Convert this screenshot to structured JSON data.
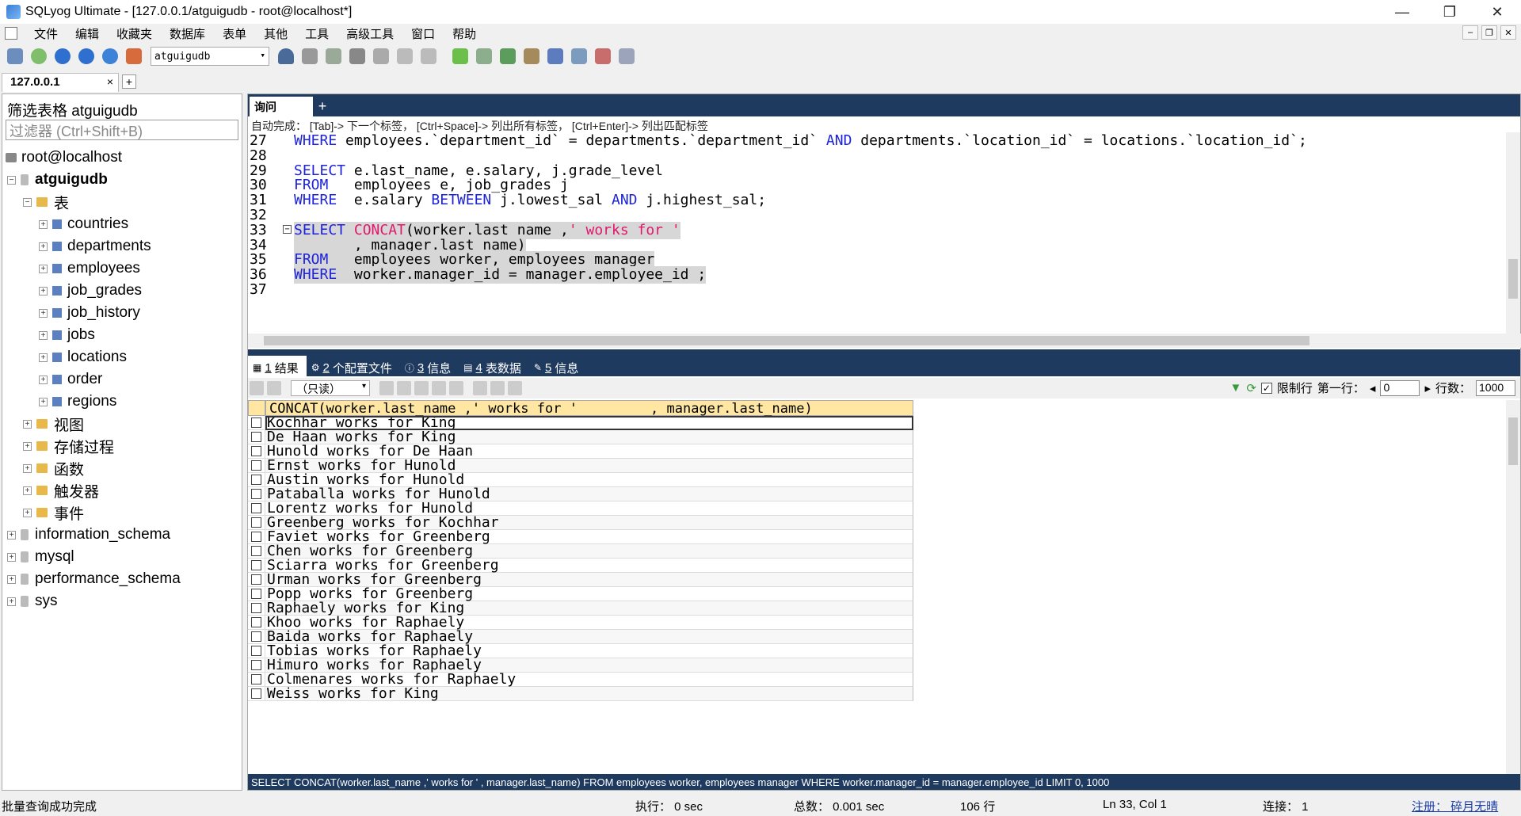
{
  "window": {
    "title": "SQLyog Ultimate - [127.0.0.1/atguigudb - root@localhost*]"
  },
  "menu": [
    "文件",
    "编辑",
    "收藏夹",
    "数据库",
    "表单",
    "其他",
    "工具",
    "高级工具",
    "窗口",
    "帮助"
  ],
  "toolbar": {
    "db_selected": "atguigudb"
  },
  "connection_tab": {
    "label": "127.0.0.1",
    "close": "×",
    "new": "+"
  },
  "sidebar": {
    "filter_label": "筛选表格 atguigudb",
    "filter_placeholder": "过滤器 (Ctrl+Shift+B)",
    "tree": [
      {
        "label": "root@localhost",
        "type": "host"
      },
      {
        "label": "atguigudb",
        "type": "db",
        "expanded": true
      },
      {
        "label": "表",
        "type": "folder",
        "expanded": true
      },
      {
        "label": "countries",
        "type": "table"
      },
      {
        "label": "departments",
        "type": "table"
      },
      {
        "label": "employees",
        "type": "table"
      },
      {
        "label": "job_grades",
        "type": "table"
      },
      {
        "label": "job_history",
        "type": "table"
      },
      {
        "label": "jobs",
        "type": "table"
      },
      {
        "label": "locations",
        "type": "table"
      },
      {
        "label": "order",
        "type": "table"
      },
      {
        "label": "regions",
        "type": "table"
      },
      {
        "label": "视图",
        "type": "folder"
      },
      {
        "label": "存储过程",
        "type": "folder"
      },
      {
        "label": "函数",
        "type": "folder"
      },
      {
        "label": "触发器",
        "type": "folder"
      },
      {
        "label": "事件",
        "type": "folder"
      },
      {
        "label": "information_schema",
        "type": "db"
      },
      {
        "label": "mysql",
        "type": "db"
      },
      {
        "label": "performance_schema",
        "type": "db"
      },
      {
        "label": "sys",
        "type": "db"
      }
    ]
  },
  "query_tab": {
    "label": "询问",
    "new": "+"
  },
  "autocomplete_hint": "自动完成： [Tab]-> 下一个标签， [Ctrl+Space]-> 列出所有标签， [Ctrl+Enter]-> 列出匹配标签",
  "editor_lines": [
    {
      "n": "27",
      "code": "WHERE employees.`department_id` = departments.`department_id` AND departments.`location_id` = locations.`location_id`;"
    },
    {
      "n": "28",
      "code": ""
    },
    {
      "n": "29",
      "code": "SELECT e.last_name, e.salary, j.grade_level"
    },
    {
      "n": "30",
      "code": "FROM   employees e, job_grades j"
    },
    {
      "n": "31",
      "code": "WHERE  e.salary BETWEEN j.lowest_sal AND j.highest_sal;"
    },
    {
      "n": "32",
      "code": ""
    },
    {
      "n": "33",
      "code": "SELECT CONCAT(worker.last_name ,' works for '"
    },
    {
      "n": "34",
      "code": "       , manager.last_name)"
    },
    {
      "n": "35",
      "code": "FROM   employees worker, employees manager"
    },
    {
      "n": "36",
      "code": "WHERE  worker.manager_id = manager.employee_id ;"
    },
    {
      "n": "37",
      "code": ""
    }
  ],
  "result_tabs": [
    {
      "n": "1",
      "label": "结果"
    },
    {
      "n": "2",
      "label": "个配置文件"
    },
    {
      "n": "3",
      "label": "信息"
    },
    {
      "n": "4",
      "label": "表数据"
    },
    {
      "n": "5",
      "label": "信息"
    }
  ],
  "result_toolbar": {
    "mode": "（只读）",
    "limit_label": "限制行",
    "first_row_label": "第一行：",
    "first_row_value": "0",
    "rows_label": "行数：",
    "rows_value": "1000"
  },
  "grid": {
    "column": "CONCAT(worker.last_name ,' works for '         , manager.last_name)",
    "rows": [
      "Kochhar works for King",
      "De Haan works for King",
      "Hunold works for De Haan",
      "Ernst works for Hunold",
      "Austin works for Hunold",
      "Pataballa works for Hunold",
      "Lorentz works for Hunold",
      "Greenberg works for Kochhar",
      "Faviet works for Greenberg",
      "Chen works for Greenberg",
      "Sciarra works for Greenberg",
      "Urman works for Greenberg",
      "Popp works for Greenberg",
      "Raphaely works for King",
      "Khoo works for Raphaely",
      "Baida works for Raphaely",
      "Tobias works for Raphaely",
      "Himuro works for Raphaely",
      "Colmenares works for Raphaely",
      "Weiss works for King"
    ]
  },
  "sql_status": "SELECT CONCAT(worker.last_name ,' works for ' , manager.last_name) FROM employees worker, employees manager WHERE worker.manager_id = manager.employee_id LIMIT 0, 1000",
  "statusbar": {
    "message": "批量查询成功完成",
    "exec": "执行： 0 sec",
    "total": "总数： 0.001 sec",
    "rows": "106 行",
    "position": "Ln 33, Col 1",
    "connections": "连接： 1",
    "register": "注册： 碎月无晴"
  }
}
